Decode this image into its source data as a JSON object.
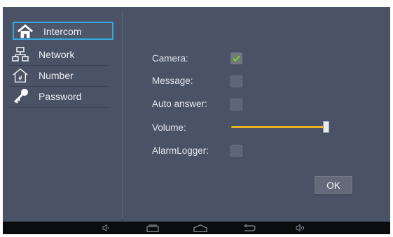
{
  "sidebar": {
    "items": [
      {
        "label": "Intercom",
        "icon": "home-icon",
        "active": true
      },
      {
        "label": "Network",
        "icon": "network-icon",
        "active": false
      },
      {
        "label": "Number",
        "icon": "number-house-icon",
        "active": false
      },
      {
        "label": "Password",
        "icon": "key-icon",
        "active": false
      }
    ]
  },
  "form": {
    "camera_label": "Camera:",
    "camera_checked": true,
    "message_label": "Message:",
    "message_checked": false,
    "auto_answer_label": "Auto answer:",
    "auto_answer_checked": false,
    "volume_label": "Volume:",
    "volume_level": 1.0,
    "alarm_logger_label": "AlarmLogger:",
    "alarm_logger_checked": false,
    "ok_label": "OK"
  },
  "navbar": {
    "icons": [
      "volume-down-icon",
      "recent-apps-icon",
      "home-icon",
      "back-icon",
      "volume-up-icon"
    ]
  },
  "colors": {
    "background": "#4a5265",
    "accent_selection": "#36a8e0",
    "slider": "#e8b51f",
    "checkmark": "#7ed321",
    "navbar": "#0b0c0e"
  }
}
